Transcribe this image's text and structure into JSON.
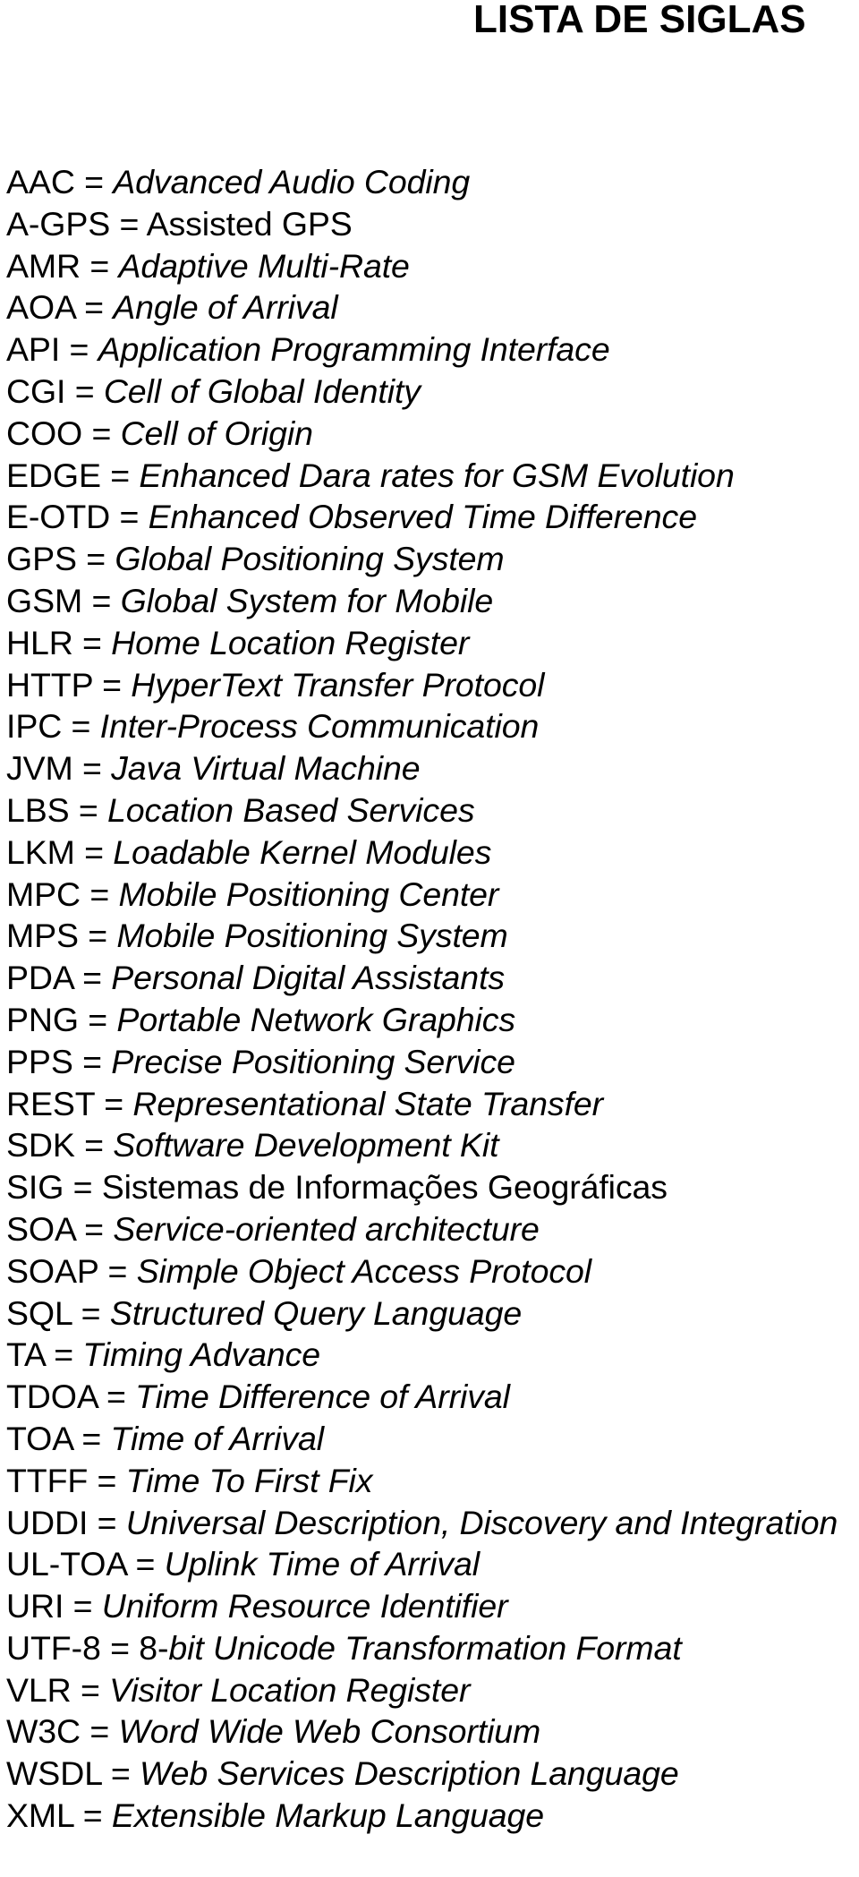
{
  "document": {
    "title": "LISTA DE SIGLAS",
    "separator": " = ",
    "entries": [
      {
        "abbr": "AAC",
        "prefix": "",
        "definition": "Advanced Audio Coding",
        "italic": true
      },
      {
        "abbr": "A-GPS",
        "prefix": "",
        "definition": "Assisted GPS",
        "italic": false
      },
      {
        "abbr": "AMR",
        "prefix": "",
        "definition": "Adaptive Multi-Rate",
        "italic": true
      },
      {
        "abbr": "AOA",
        "prefix": "",
        "definition": "Angle of Arrival",
        "italic": true
      },
      {
        "abbr": "API",
        "prefix": "",
        "definition": "Application Programming Interface",
        "italic": true
      },
      {
        "abbr": "CGI",
        "prefix": "",
        "definition": "Cell of Global Identity",
        "italic": true
      },
      {
        "abbr": "COO",
        "prefix": "",
        "definition": "Cell of Origin",
        "italic": true
      },
      {
        "abbr": "EDGE",
        "prefix": "",
        "definition": "Enhanced Dara rates for GSM Evolution",
        "italic": true
      },
      {
        "abbr": "E-OTD",
        "prefix": "",
        "definition": "Enhanced Observed Time Difference",
        "italic": true
      },
      {
        "abbr": "GPS",
        "prefix": "",
        "definition": "Global Positioning System",
        "italic": true
      },
      {
        "abbr": "GSM",
        "prefix": "",
        "definition": "Global System for Mobile",
        "italic": true
      },
      {
        "abbr": "HLR",
        "prefix": "",
        "definition": "Home Location Register",
        "italic": true
      },
      {
        "abbr": "HTTP",
        "prefix": "",
        "definition": "HyperText Transfer Protocol",
        "italic": true
      },
      {
        "abbr": "IPC",
        "prefix": "",
        "definition": "Inter-Process Communication",
        "italic": true
      },
      {
        "abbr": "JVM",
        "prefix": "",
        "definition": "Java Virtual Machine",
        "italic": true
      },
      {
        "abbr": "LBS",
        "prefix": "",
        "definition": "Location Based Services",
        "italic": true
      },
      {
        "abbr": "LKM",
        "prefix": "",
        "definition": "Loadable Kernel Modules",
        "italic": true
      },
      {
        "abbr": "MPC",
        "prefix": "",
        "definition": "Mobile Positioning Center",
        "italic": true
      },
      {
        "abbr": "MPS",
        "prefix": "",
        "definition": "Mobile Positioning System",
        "italic": true
      },
      {
        "abbr": "PDA",
        "prefix": "",
        "definition": "Personal Digital Assistants",
        "italic": true
      },
      {
        "abbr": "PNG",
        "prefix": "",
        "definition": "Portable Network Graphics",
        "italic": true
      },
      {
        "abbr": "PPS",
        "prefix": "",
        "definition": "Precise Positioning Service",
        "italic": true
      },
      {
        "abbr": "REST",
        "prefix": "",
        "definition": "Representational State Transfer",
        "italic": true
      },
      {
        "abbr": "SDK",
        "prefix": "",
        "definition": "Software Development Kit",
        "italic": true
      },
      {
        "abbr": "SIG",
        "prefix": "",
        "definition": "Sistemas de Informações Geográficas",
        "italic": false
      },
      {
        "abbr": "SOA",
        "prefix": "",
        "definition": "Service-oriented architecture",
        "italic": true
      },
      {
        "abbr": "SOAP",
        "prefix": "",
        "definition": "Simple Object Access Protocol",
        "italic": true
      },
      {
        "abbr": "SQL",
        "prefix": "",
        "definition": "Structured Query Language",
        "italic": true
      },
      {
        "abbr": "TA",
        "prefix": "",
        "definition": "Timing Advance",
        "italic": true
      },
      {
        "abbr": "TDOA",
        "prefix": "",
        "definition": "Time Difference of Arrival",
        "italic": true
      },
      {
        "abbr": "TOA",
        "prefix": "",
        "definition": "Time of Arrival",
        "italic": true
      },
      {
        "abbr": "TTFF",
        "prefix": "",
        "definition": "Time To First Fix",
        "italic": true
      },
      {
        "abbr": "UDDI",
        "prefix": "",
        "definition": "Universal Description, Discovery and Integration",
        "italic": true
      },
      {
        "abbr": "UL-TOA",
        "prefix": "",
        "definition": "Uplink Time of Arrival",
        "italic": true
      },
      {
        "abbr": "URI",
        "prefix": "",
        "definition": "Uniform Resource Identifier",
        "italic": true
      },
      {
        "abbr": "UTF-8",
        "prefix": "8-",
        "definition": "bit Unicode Transformation Format",
        "italic": true
      },
      {
        "abbr": "VLR",
        "prefix": "",
        "definition": "Visitor Location Register",
        "italic": true
      },
      {
        "abbr": "W3C",
        "prefix": "",
        "definition": "Word Wide Web Consortium",
        "italic": true
      },
      {
        "abbr": "WSDL",
        "prefix": "",
        "definition": "Web Services Description Language",
        "italic": true
      },
      {
        "abbr": "XML",
        "prefix": "",
        "definition": "Extensible Markup Language",
        "italic": true
      }
    ]
  }
}
